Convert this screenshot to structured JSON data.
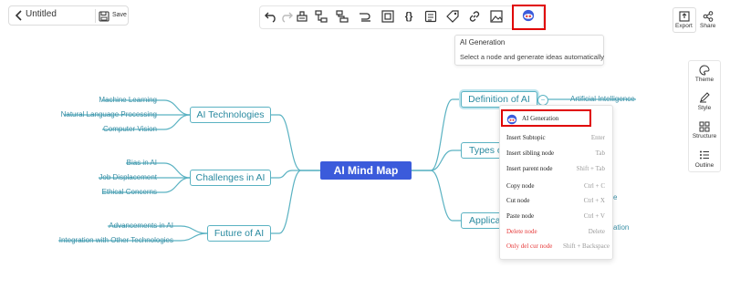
{
  "header": {
    "title": "Untitled",
    "save_label": "Save"
  },
  "tooltip": {
    "title": "AI Generation",
    "description": "Select a node and generate ideas automatically"
  },
  "top_right": {
    "export_label": "Export",
    "share_label": "Share"
  },
  "sidebar": {
    "items": [
      {
        "label": "Theme"
      },
      {
        "label": "Style"
      },
      {
        "label": "Structure"
      },
      {
        "label": "Outline"
      }
    ]
  },
  "mindmap": {
    "root": "AI Mind Map",
    "left_topics": [
      {
        "label": "AI Technologies",
        "children": [
          "Machine Learning",
          "Natural Language Processing",
          "Computer Vision"
        ]
      },
      {
        "label": "Challenges in AI",
        "children": [
          "Bias in AI",
          "Job Displacement",
          "Ethical Concerns"
        ]
      },
      {
        "label": "Future of AI",
        "children": [
          "Advancements in AI",
          "Integration with Other Technologies"
        ]
      }
    ],
    "right_topics": [
      {
        "label": "Definition of AI",
        "children": [
          "Artificial Intelligence"
        ]
      },
      {
        "label": "Types o"
      },
      {
        "label": "Applica"
      }
    ],
    "right_partial": [
      "e",
      "ation"
    ],
    "collapse_symbol": "−"
  },
  "context_menu": {
    "items": [
      {
        "label": "AI Generation"
      },
      {
        "label": "Insert Subtopic",
        "shortcut": "Enter"
      },
      {
        "label": "Insert sibling node",
        "shortcut": "Tab"
      },
      {
        "label": "Insert parent node",
        "shortcut": "Shift + Tab"
      },
      {
        "label": "Copy node",
        "shortcut": "Ctrl + C"
      },
      {
        "label": "Cut node",
        "shortcut": "Ctrl + X"
      },
      {
        "label": "Paste node",
        "shortcut": "Ctrl + V"
      },
      {
        "label": "Delete node",
        "shortcut": "Delete"
      },
      {
        "label": "Only del cur node",
        "shortcut": "Shift + Backspace"
      }
    ]
  },
  "colors": {
    "accent": "#3b5bdb",
    "branch": "#5ab2c2",
    "highlight": "#e00000",
    "danger": "#e63939"
  }
}
